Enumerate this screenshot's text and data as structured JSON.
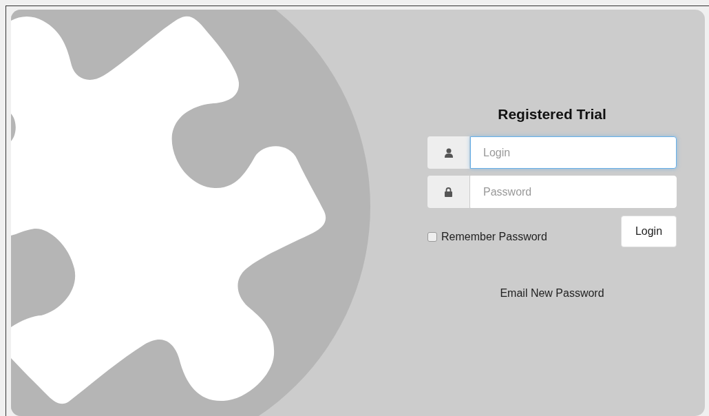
{
  "title": "Registered Trial",
  "fields": [
    {
      "kind": "user",
      "placeholder": "Login",
      "focused": true
    },
    {
      "kind": "password",
      "placeholder": "Password",
      "focused": false
    }
  ],
  "remember": {
    "label": "Remember Password",
    "checked": false
  },
  "login_button": "Login",
  "email_link": "Email New Password"
}
